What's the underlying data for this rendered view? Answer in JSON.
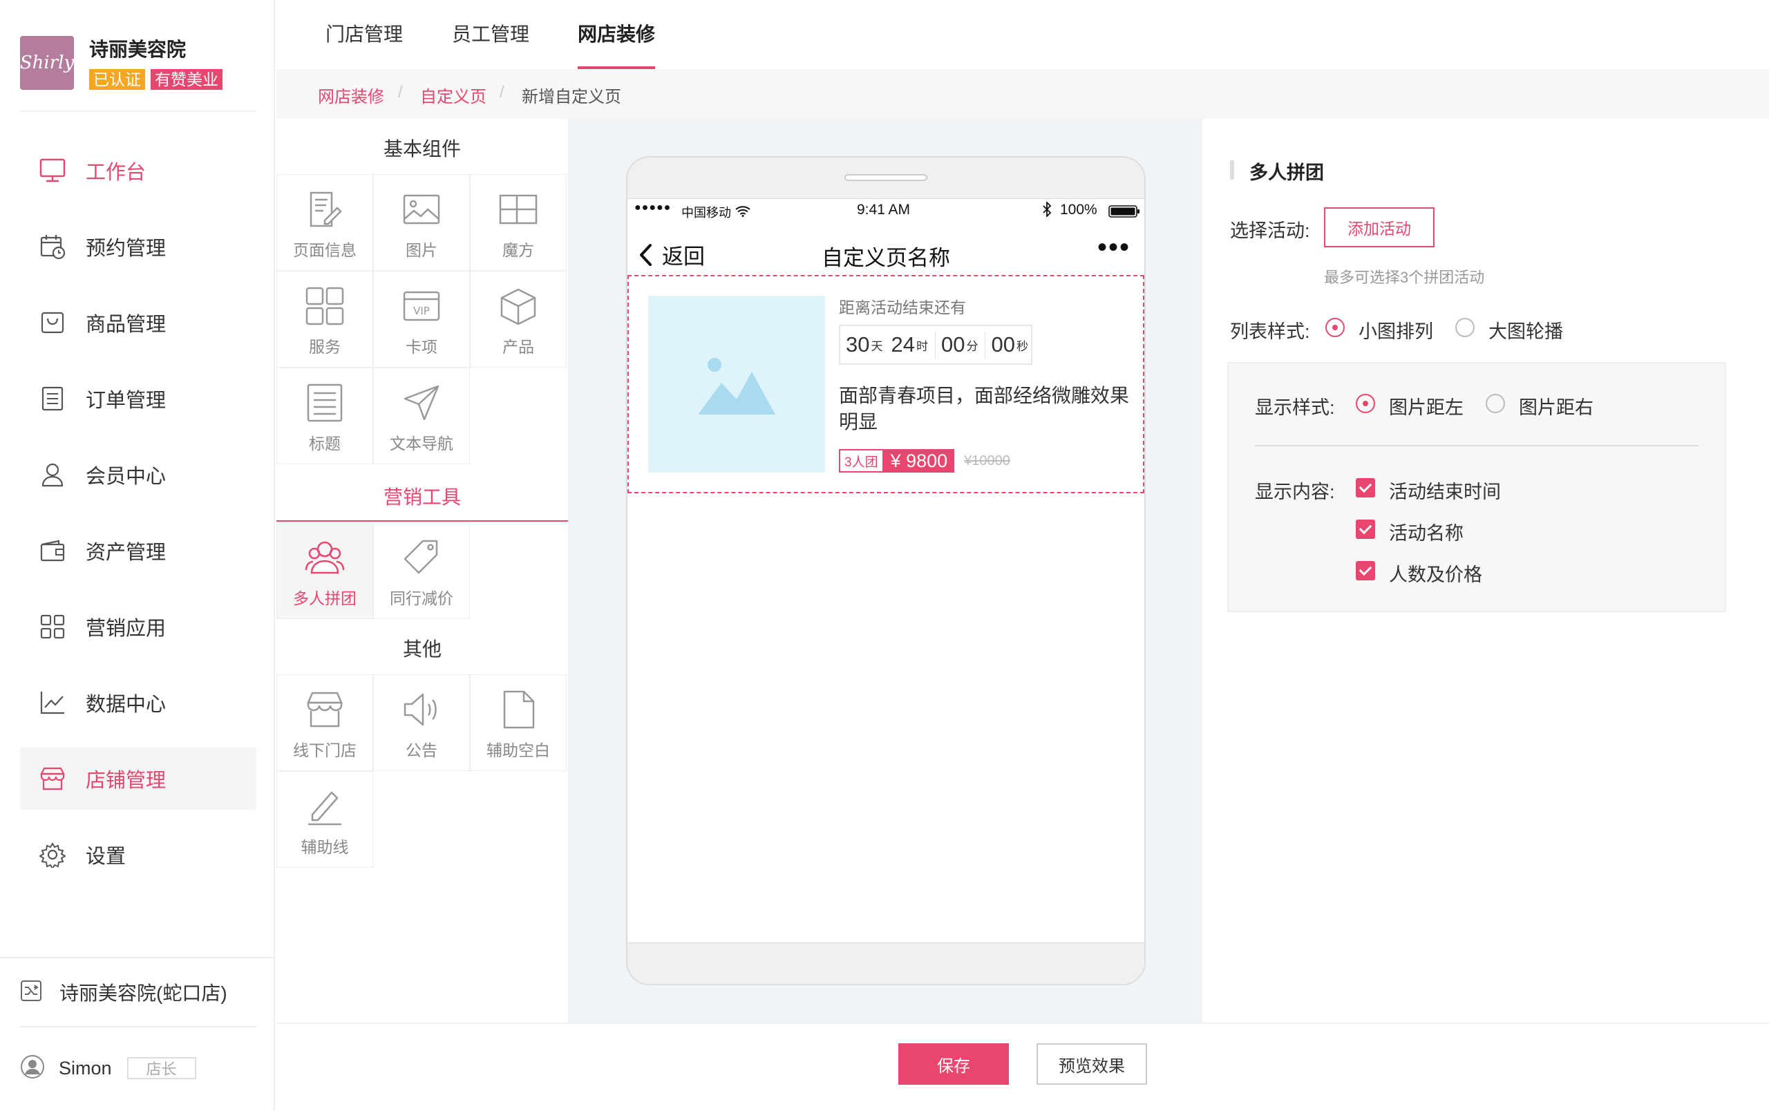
{
  "sidebar": {
    "logo_text": "Shirly",
    "store_name": "诗丽美容院",
    "badges": [
      "已认证",
      "有赞美业"
    ],
    "items": [
      {
        "label": "工作台",
        "icon": "monitor-icon"
      },
      {
        "label": "预约管理",
        "icon": "calendar-clock-icon"
      },
      {
        "label": "商品管理",
        "icon": "shopping-bag-icon"
      },
      {
        "label": "订单管理",
        "icon": "document-list-icon"
      },
      {
        "label": "会员中心",
        "icon": "user-icon"
      },
      {
        "label": "资产管理",
        "icon": "wallet-icon"
      },
      {
        "label": "营销应用",
        "icon": "grid-apps-icon"
      },
      {
        "label": "数据中心",
        "icon": "line-chart-icon"
      },
      {
        "label": "店铺管理",
        "icon": "store-icon"
      },
      {
        "label": "设置",
        "icon": "gear-icon"
      }
    ],
    "branch": "诗丽美容院(蛇口店)",
    "user_name": "Simon",
    "user_role": "店长"
  },
  "top_nav": {
    "tabs": [
      "门店管理",
      "员工管理",
      "网店装修"
    ],
    "active_tab": "网店装修"
  },
  "breadcrumb": [
    "网店装修",
    "自定义页",
    "新增自定义页"
  ],
  "components": {
    "basic_title": "基本组件",
    "basic": [
      {
        "label": "页面信息",
        "icon": "edit-page-icon"
      },
      {
        "label": "图片",
        "icon": "image-icon"
      },
      {
        "label": "魔方",
        "icon": "cube-layout-icon"
      },
      {
        "label": "服务",
        "icon": "grid-service-icon"
      },
      {
        "label": "卡项",
        "icon": "vip-card-icon"
      },
      {
        "label": "产品",
        "icon": "box-icon"
      },
      {
        "label": "标题",
        "icon": "title-icon"
      },
      {
        "label": "文本导航",
        "icon": "send-icon"
      }
    ],
    "marketing_title": "营销工具",
    "marketing": [
      {
        "label": "多人拼团",
        "icon": "group-users-icon"
      },
      {
        "label": "同行减价",
        "icon": "price-tag-icon"
      }
    ],
    "other_title": "其他",
    "other": [
      {
        "label": "线下门店",
        "icon": "shop-icon"
      },
      {
        "label": "公告",
        "icon": "speaker-icon"
      },
      {
        "label": "辅助空白",
        "icon": "blank-page-icon"
      },
      {
        "label": "辅助线",
        "icon": "pencil-icon"
      }
    ]
  },
  "preview": {
    "signal": "●●●●●",
    "carrier": "中国移动",
    "time": "9:41 AM",
    "battery": "100%",
    "back_label": "返回",
    "page_title": "自定义页名称",
    "more": "•••",
    "card": {
      "countdown_label": "距离活动结束还有",
      "days": "30",
      "days_unit": "天",
      "hours": "24",
      "hours_unit": "时",
      "minutes": "00",
      "minutes_unit": "分",
      "seconds": "00",
      "seconds_unit": "秒",
      "title": "面部青春项目，面部经络微雕效果明显",
      "group_tag": "3人团",
      "price": "¥ 9800",
      "original_price": "¥10000"
    }
  },
  "settings": {
    "title": "多人拼团",
    "select_label": "选择活动:",
    "add_button": "添加活动",
    "hint": "最多可选择3个拼团活动",
    "list_style_label": "列表样式:",
    "list_options": [
      "小图排列",
      "大图轮播"
    ],
    "list_selected": 0,
    "display_style_label": "显示样式:",
    "display_options": [
      "图片距左",
      "图片距右"
    ],
    "display_selected": 0,
    "content_label": "显示内容:",
    "content_options": [
      "活动结束时间",
      "活动名称",
      "人数及价格"
    ]
  },
  "footer": {
    "save": "保存",
    "preview": "预览效果"
  },
  "colors": {
    "accent": "#e8466e",
    "badge_verified": "#f5a623",
    "badge_brand": "#e8466e",
    "image_placeholder": "#dff3fb"
  }
}
